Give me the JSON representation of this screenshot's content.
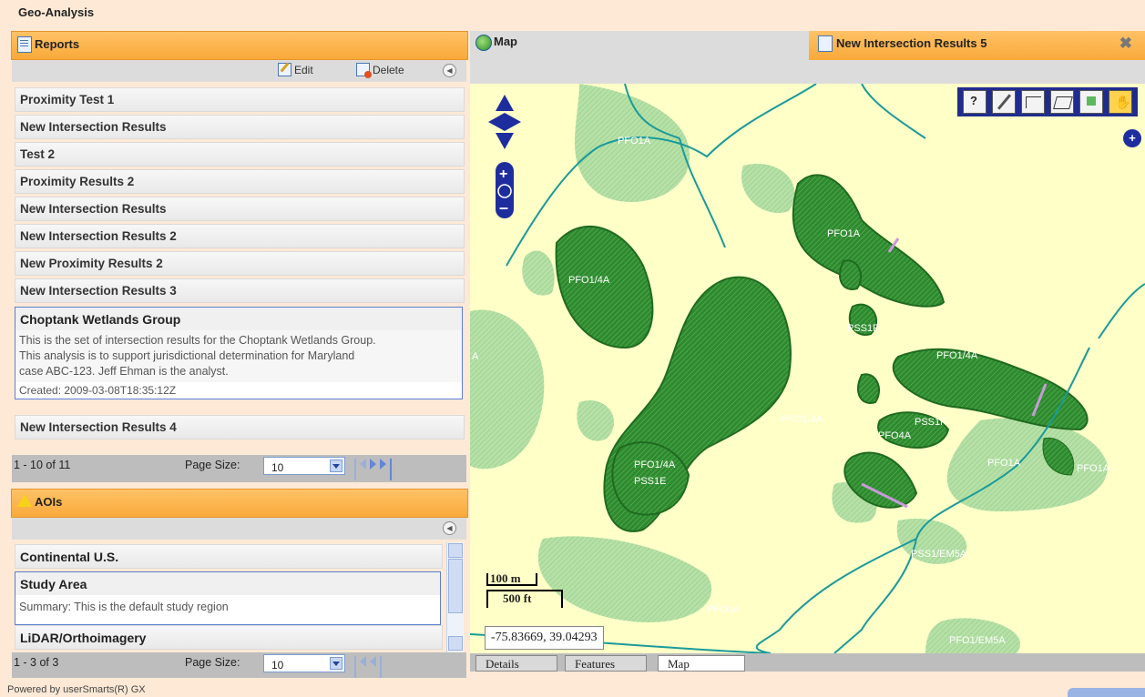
{
  "app_title": "Geo-Analysis",
  "reports": {
    "title": "Reports",
    "edit_label": "Edit",
    "delete_label": "Delete",
    "items": [
      "Proximity Test 1",
      "New Intersection Results",
      "Test 2",
      "Proximity Results 2",
      "New Intersection Results",
      "New Intersection Results 2",
      "New Proximity Results 2",
      "New Intersection Results 3"
    ],
    "selected": {
      "title": "Choptank Wetlands Group",
      "description_1": "This is the set of intersection results for the Choptank Wetlands Group.",
      "description_2": "This analysis is to support jurisdictional determination for Maryland",
      "description_3": "case ABC-123. Jeff Ehman is the analyst.",
      "created": "Created: 2009-03-08T18:35:12Z"
    },
    "last_item": "New Intersection Results 4",
    "pager": {
      "count": "1 - 10 of 11",
      "page_size_label": "Page Size:",
      "page_size": "10"
    }
  },
  "aois": {
    "title": "AOIs",
    "items": [
      "Continental U.S.",
      "LiDAR/Orthoimagery"
    ],
    "selected": {
      "title": "Study Area",
      "summary": "Summary: This is the default study region"
    },
    "pager": {
      "count": "1 - 3 of 3",
      "page_size_label": "Page Size:",
      "page_size": "10"
    }
  },
  "footer": "Powered by userSmarts(R) GX",
  "map_panel": {
    "tab_map": "Map",
    "tab_results": "New Intersection Results 5",
    "coordinates": "-75.83669, 39.04293",
    "scale_m": "100 m",
    "scale_ft": "500 ft",
    "bottom_tabs": [
      "Details",
      "Features",
      "Map"
    ],
    "labels": [
      "PFO1A",
      "PFO1A",
      "PFO1/4A",
      "PSS1F",
      "PFO1/4A",
      "A",
      "PFO1/4A",
      "PSS1F",
      "PFO4A",
      "PFO1/4A",
      "PSS1E",
      "PFO1A",
      "PFO1A",
      "PSS1/EM5A",
      "PFO1A",
      "PFO1/EM5A"
    ],
    "tools": [
      "help-icon",
      "pencil-icon",
      "polyline-icon",
      "polygon-icon",
      "select-icon",
      "pan-hand-icon"
    ]
  }
}
